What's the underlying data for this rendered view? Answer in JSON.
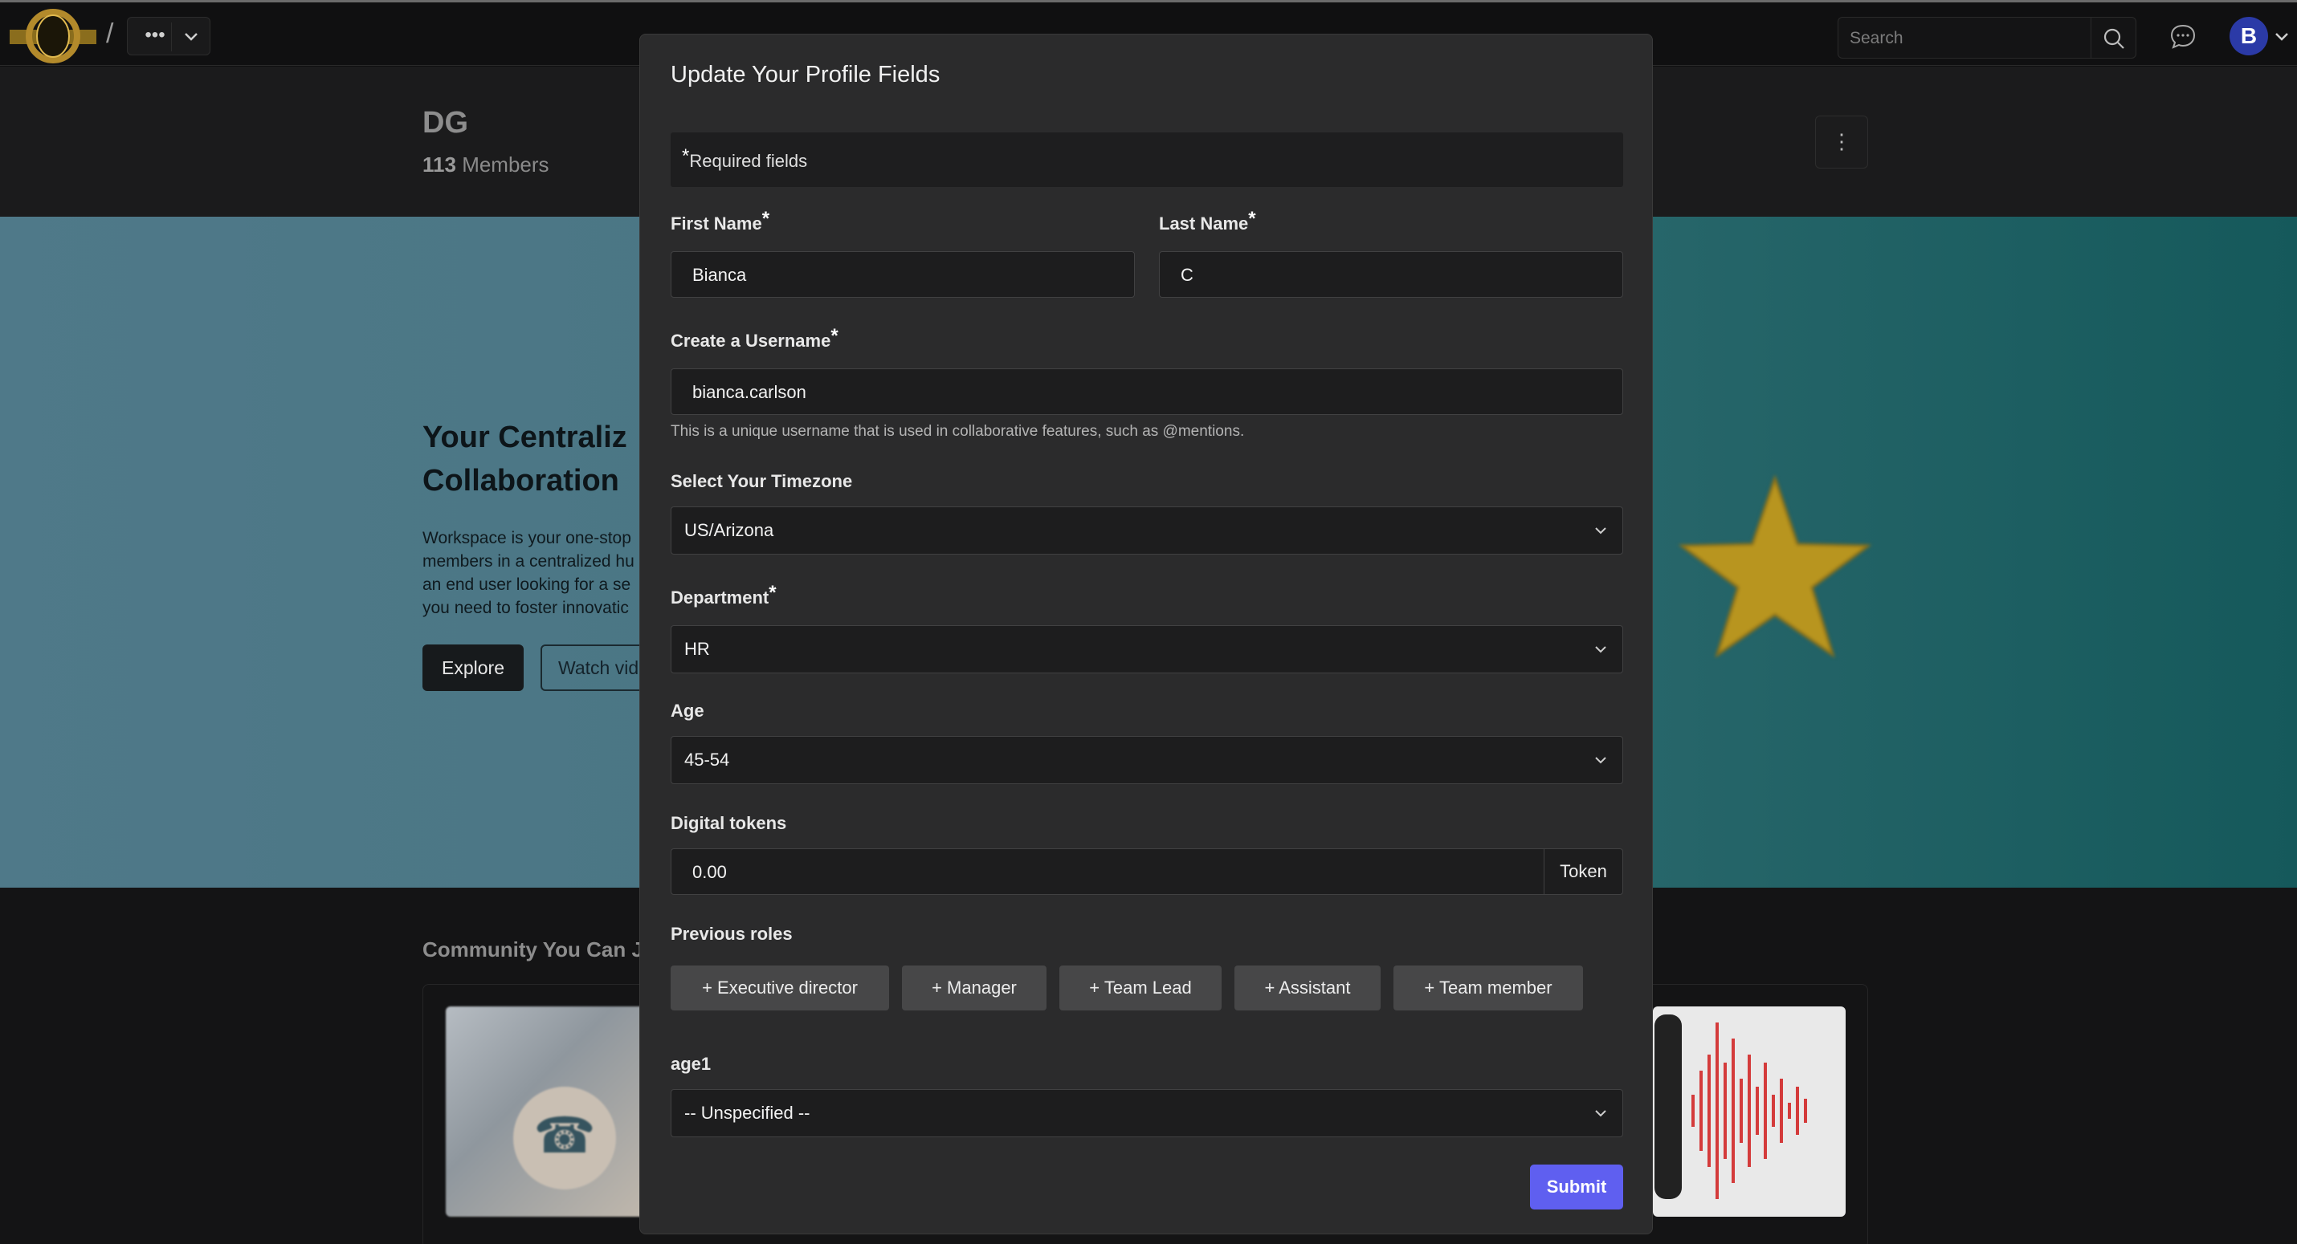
{
  "topbar": {
    "logo_icon": "ring-logo-icon",
    "breadcrumb_separator": "/",
    "more_label": "•••",
    "search_placeholder": "Search",
    "avatar_initial": "B"
  },
  "group": {
    "title": "DG",
    "member_count": "113",
    "members_label": "Members",
    "menu_label": "⋮"
  },
  "hero": {
    "title_line1": "Your Centraliz",
    "title_line2": "Collaboration",
    "desc_lines": [
      "Workspace is your one-stop",
      "members in a centralized hu",
      "an end user looking for a se",
      "you need to foster innovatic"
    ],
    "explore_label": "Explore",
    "watch_label": "Watch vid"
  },
  "community": {
    "title": "Community You Can J"
  },
  "modal": {
    "title": "Update Your Profile Fields",
    "required_note": "Required fields",
    "required_marker": "*",
    "first_name": {
      "label": "First Name",
      "value": "Bianca"
    },
    "last_name": {
      "label": "Last Name",
      "value": "C"
    },
    "username": {
      "label": "Create a Username",
      "value": "bianca.carlson",
      "help": "This is a unique username that is used in collaborative features, such as @mentions."
    },
    "timezone": {
      "label": "Select Your Timezone",
      "value": "US/Arizona"
    },
    "department": {
      "label": "Department",
      "value": "HR"
    },
    "age": {
      "label": "Age",
      "value": "45-54"
    },
    "tokens": {
      "label": "Digital tokens",
      "value": "0.00",
      "unit": "Token"
    },
    "previous_roles": {
      "label": "Previous roles",
      "options": [
        "+ Executive director",
        "+ Manager",
        "+ Team Lead",
        "+ Assistant",
        "+ Team member"
      ]
    },
    "age1": {
      "label": "age1",
      "value": "-- Unspecified --"
    },
    "submit_label": "Submit"
  },
  "colors": {
    "accent": "#5f5ff0",
    "avatar_bg": "#2b3aa7",
    "modal_bg": "#2b2b2c"
  }
}
